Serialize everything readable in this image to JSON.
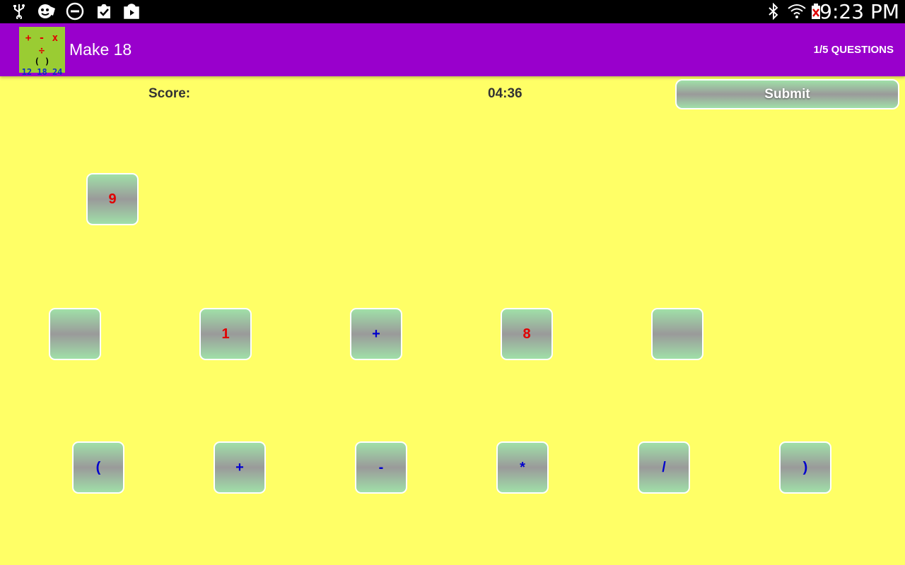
{
  "status_bar": {
    "time": "9:23 PM",
    "left_icons": [
      "usb-icon",
      "mask-icon",
      "do-not-disturb-icon",
      "clipboard-check-icon",
      "play-store-icon"
    ],
    "right_icons": [
      "bluetooth-icon",
      "wifi-icon",
      "battery-icon"
    ]
  },
  "action_bar": {
    "logo": {
      "ops": "+ - x ÷",
      "paren": "( )",
      "nums": "12 18 24"
    },
    "title": "Make 18",
    "questions": "1/5 QUESTIONS"
  },
  "game": {
    "score_label": "Score:",
    "timer": "04:36",
    "submit_label": "Submit",
    "top_tile": "9",
    "expression_slots": [
      "",
      "1",
      "+",
      "8",
      ""
    ],
    "operators": [
      "(",
      "+",
      "-",
      "*",
      "/",
      ")"
    ]
  },
  "colors": {
    "background": "#ffff66",
    "action_bar": "#9900cc",
    "number_text": "#e00000",
    "operator_text": "#0000cc"
  }
}
